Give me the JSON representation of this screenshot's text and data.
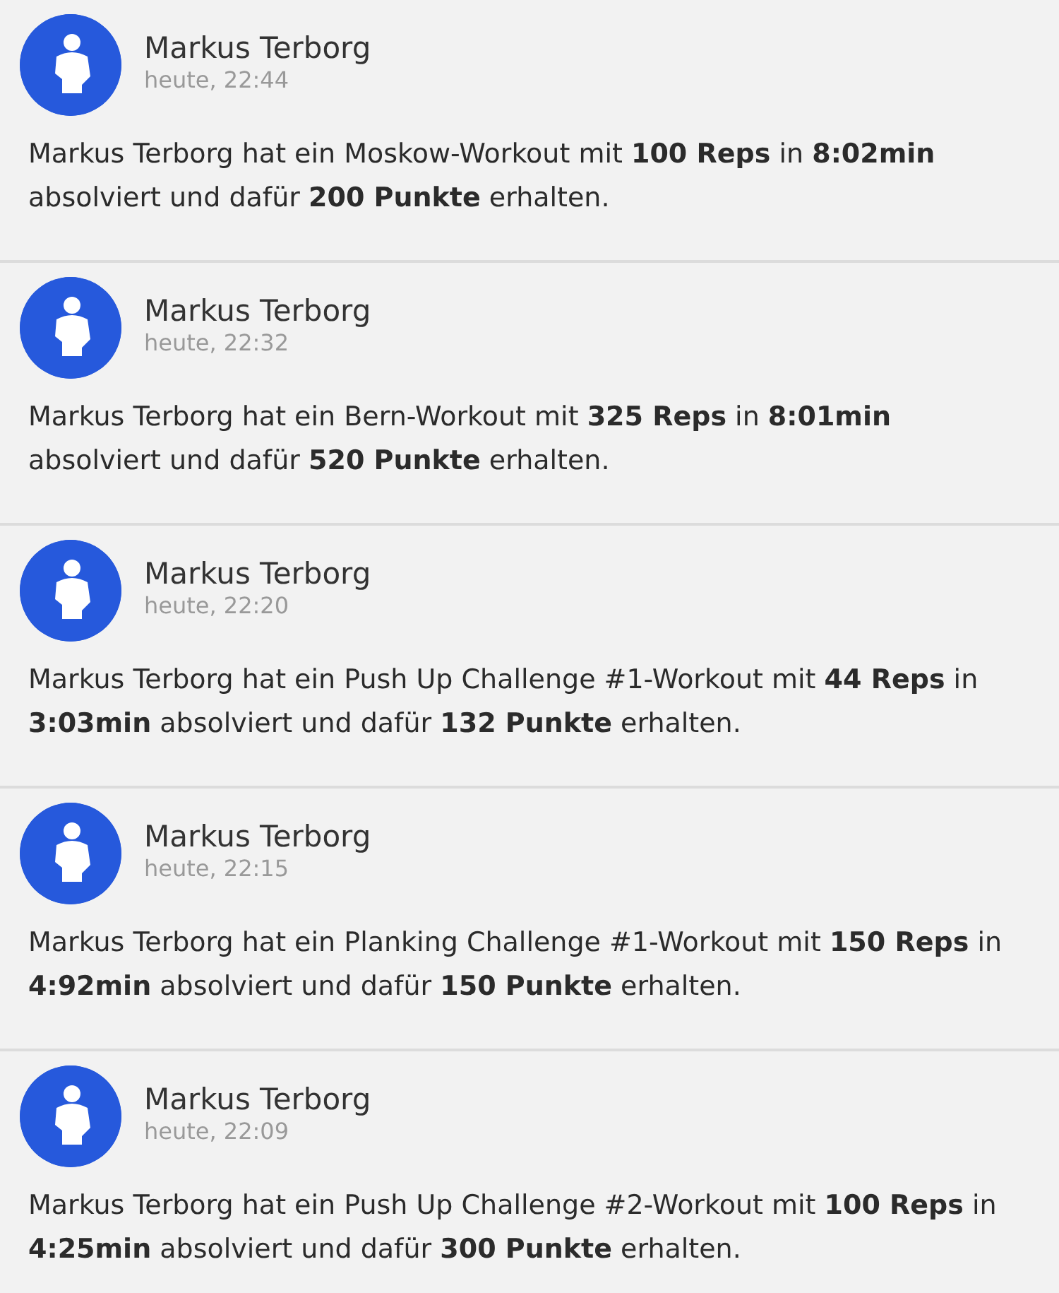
{
  "posts": [
    {
      "author": "Markus Terborg",
      "time": "heute, 22:44",
      "text": "Markus Terborg hat ein Moskow-Workout mit **100 Reps** in **8:02min** absolviert und dafür **200 Punkte** erhalten."
    },
    {
      "author": "Markus Terborg",
      "time": "heute, 22:32",
      "text": "Markus Terborg hat ein Bern-Workout mit **325 Reps** in **8:01min** absolviert und dafür **520 Punkte** erhalten."
    },
    {
      "author": "Markus Terborg",
      "time": "heute, 22:20",
      "text": "Markus Terborg hat ein Push Up Challenge #1-Workout mit **44 Reps** in **3:03min** absolviert und dafür **132 Punkte** erhalten."
    },
    {
      "author": "Markus Terborg",
      "time": "heute, 22:15",
      "text": "Markus Terborg hat ein Planking Challenge #1-Workout mit **150 Reps** in **4:92min** absolviert und dafür **150 Punkte** erhalten."
    },
    {
      "author": "Markus Terborg",
      "time": "heute, 22:09",
      "text": "Markus Terborg hat ein Push Up Challenge #2-Workout mit **100 Reps** in **4:25min** absolviert und dafür **300 Punkte** erhalten."
    }
  ]
}
